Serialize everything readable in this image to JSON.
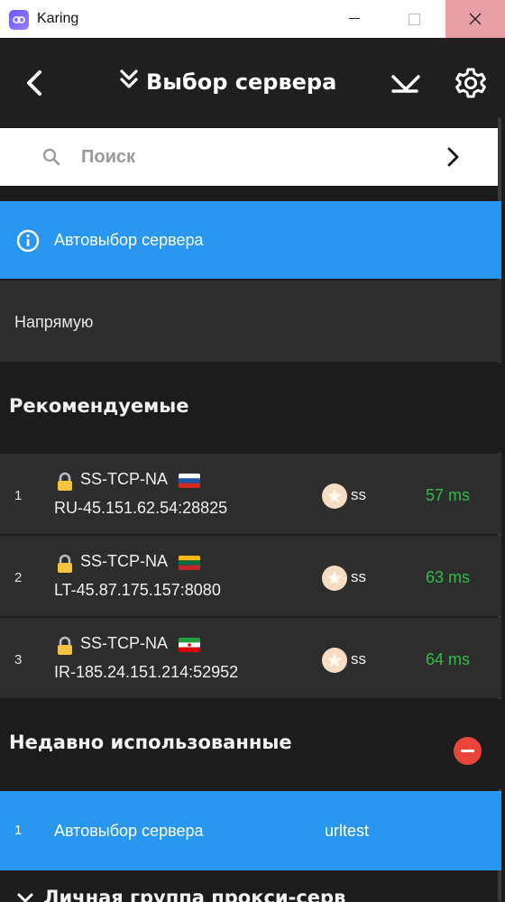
{
  "window": {
    "title": "Karing",
    "icon": "link-icon",
    "controls": [
      "minimize-icon",
      "maximize-icon",
      "close-icon"
    ],
    "close_hover_color": "#e8a0a6"
  },
  "header": {
    "title": "Выбор сервера",
    "back_icon": "chevron-left-icon",
    "title_icon": "double-chevron-down-icon",
    "actions": [
      "download-arrow-icon",
      "gear-icon"
    ]
  },
  "search": {
    "placeholder": "Поиск",
    "value": "",
    "icon": "search-icon",
    "submit_icon": "chevron-right-icon"
  },
  "auto_select": {
    "label": "Автовыбор сервера",
    "icon": "info-icon",
    "color": "#2996f0"
  },
  "direct": {
    "label": "Напрямую"
  },
  "recommended": {
    "title": "Рекомендуемые",
    "servers": [
      {
        "index": "1",
        "name": "SS-TCP-NA",
        "flag": "ru",
        "address": "RU-45.151.62.54:28825",
        "type": "ss",
        "latency": "57 ms"
      },
      {
        "index": "2",
        "name": "SS-TCP-NA",
        "flag": "lt",
        "address": "LT-45.87.175.157:8080",
        "type": "ss",
        "latency": "63 ms"
      },
      {
        "index": "3",
        "name": "SS-TCP-NA",
        "flag": "ir",
        "address": "IR-185.24.151.214:52952",
        "type": "ss",
        "latency": "64 ms"
      }
    ],
    "latency_color": "#2ebd4a"
  },
  "recent": {
    "title": "Недавно использованные",
    "remove_icon": "minus-circle-icon",
    "items": [
      {
        "index": "1",
        "label": "Автовыбор сервера",
        "type": "urltest"
      }
    ]
  },
  "group": {
    "title": "Личная группа прокси-серв",
    "icon": "chevron-down-icon"
  }
}
